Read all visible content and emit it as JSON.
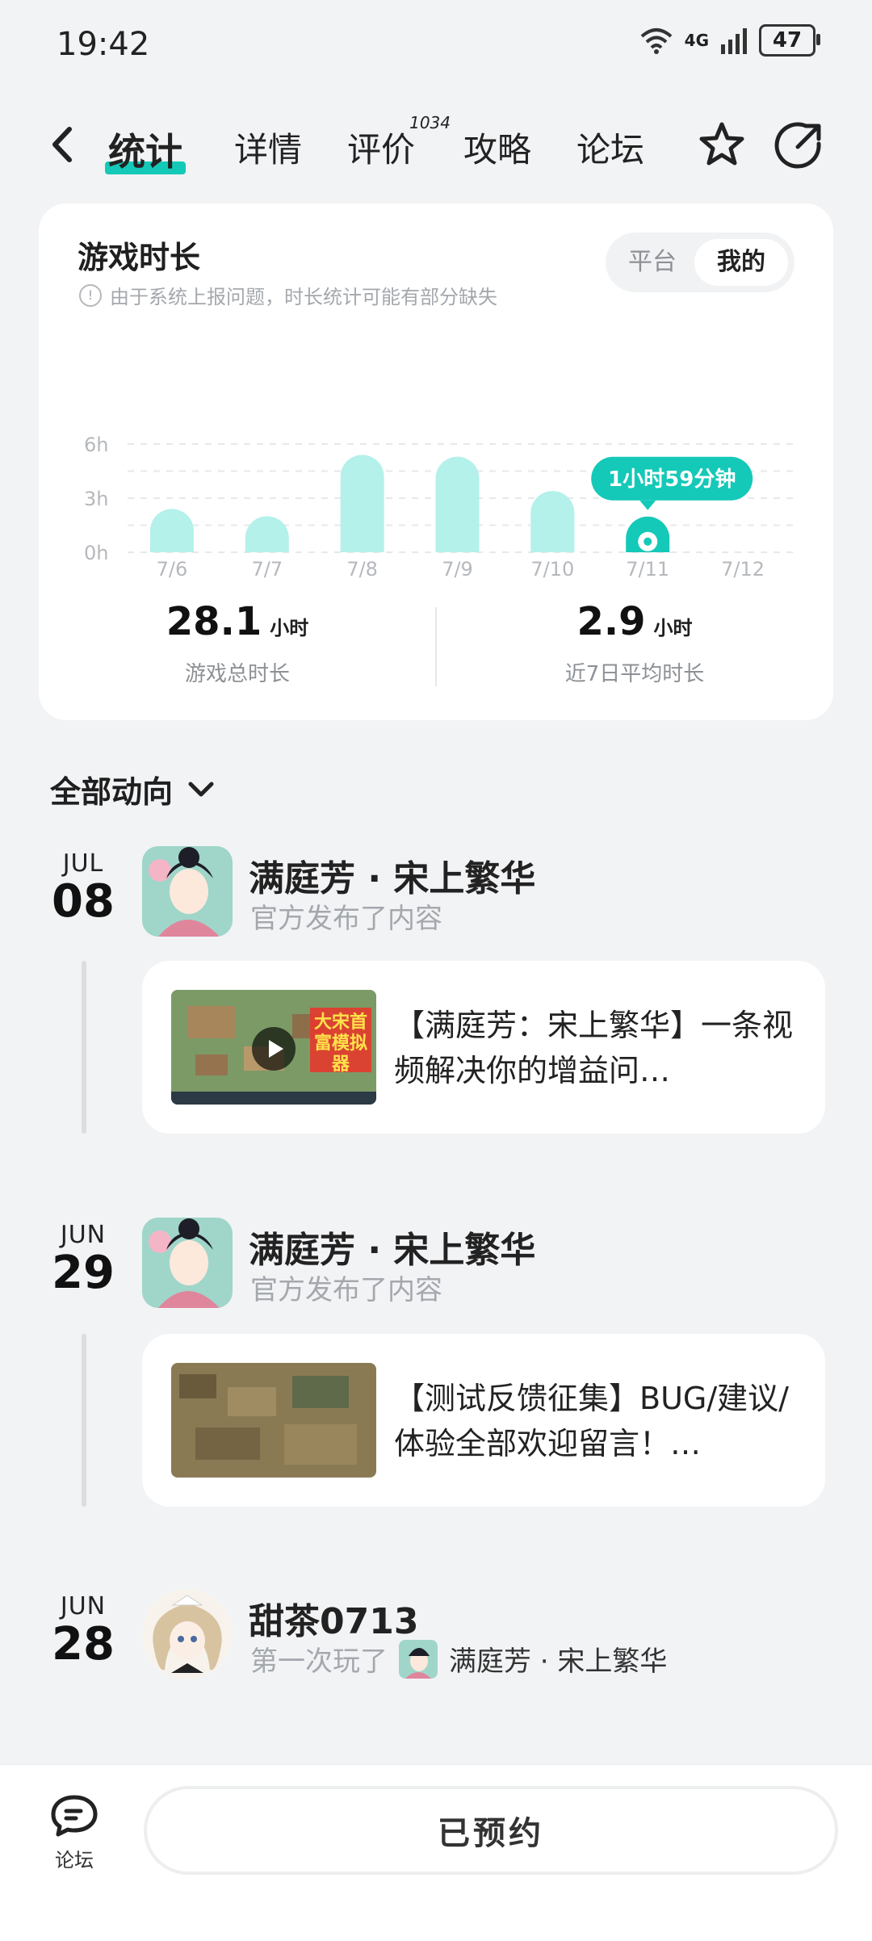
{
  "status_bar": {
    "time": "19:42",
    "network": "4G",
    "battery": "47"
  },
  "nav": {
    "tabs": [
      {
        "label": "统计",
        "active": true
      },
      {
        "label": "详情"
      },
      {
        "label": "评价",
        "badge": "1034"
      },
      {
        "label": "攻略"
      },
      {
        "label": "论坛"
      }
    ],
    "icons": [
      "back-icon",
      "star-icon",
      "share-icon"
    ]
  },
  "playtime": {
    "title": "游戏时长",
    "note": "由于系统上报问题，时长统计可能有部分缺失",
    "toggle": {
      "platform": "平台",
      "mine": "我的",
      "selected": "我的"
    },
    "tooltip": "1小时59分钟",
    "total_value": "28.1",
    "total_unit": "小时",
    "total_label": "游戏总时长",
    "avg_value": "2.9",
    "avg_unit": "小时",
    "avg_label": "近7日平均时长"
  },
  "chart_data": {
    "type": "bar",
    "categories": [
      "7/6",
      "7/7",
      "7/8",
      "7/9",
      "7/10",
      "7/11",
      "7/12"
    ],
    "values": [
      2.4,
      2.0,
      5.4,
      5.3,
      3.4,
      1.98,
      0
    ],
    "y_ticks": [
      "0h",
      "3h",
      "6h"
    ],
    "ylim": [
      0,
      6
    ],
    "highlight_index": 5,
    "grid": true,
    "colors": {
      "bar": "#b3f1ea",
      "highlight": "#14c9b8"
    }
  },
  "activity": {
    "title": "全部动向",
    "items": [
      {
        "month": "JUL",
        "day": "08",
        "name": "满庭芳 · 宋上繁华",
        "subtitle": "官方发布了内容",
        "post_text": "【满庭芳：宋上繁华】一条视频解决你的增益问…",
        "thumb_title": "大宋首富模拟器",
        "has_video": true
      },
      {
        "month": "JUN",
        "day": "29",
        "name": "满庭芳 · 宋上繁华",
        "subtitle": "官方发布了内容",
        "post_text": "【测试反馈征集】BUG/建议/体验全部欢迎留言！…",
        "has_video": false
      },
      {
        "month": "JUN",
        "day": "28",
        "name": "甜茶0713",
        "subtitle": "第一次玩了",
        "game": "满庭芳 · 宋上繁华"
      }
    ]
  },
  "bottom_bar": {
    "forum_label": "论坛",
    "reserve_label": "已预约"
  }
}
